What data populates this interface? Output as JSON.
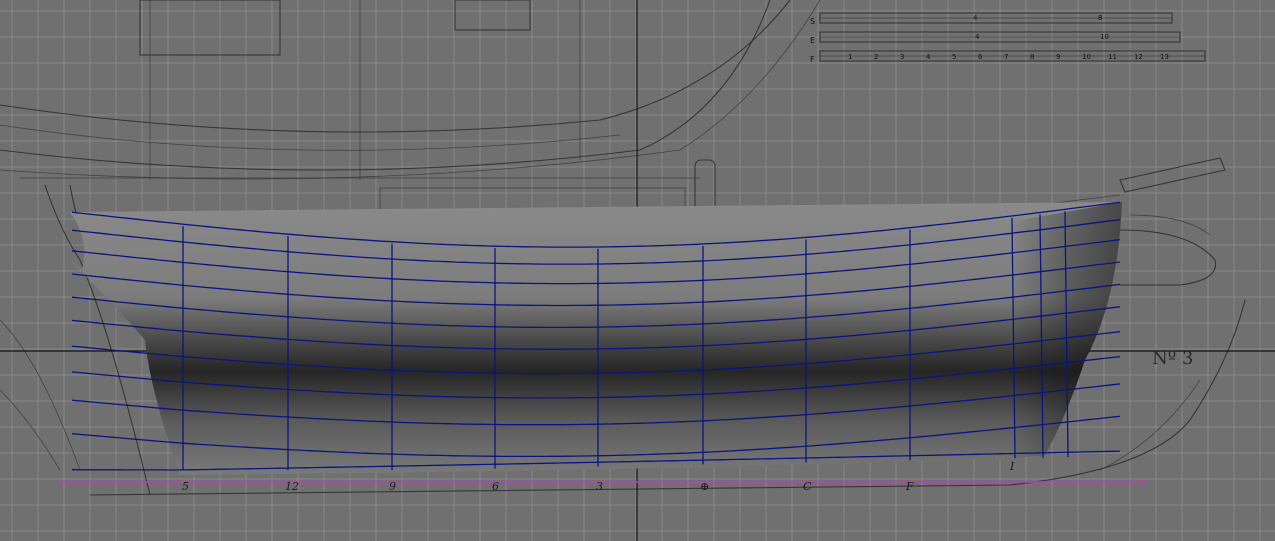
{
  "viewport": {
    "background": "#707070",
    "grid_color": "#9a9a9a",
    "mesh_color": "#0a1580",
    "baseline_color": "#c03bc0"
  },
  "drawing": {
    "plate_label": "Nº 3",
    "scale_bars": [
      {
        "letter": "S",
        "numbers": [
          "4",
          "8"
        ]
      },
      {
        "letter": "E",
        "numbers": [
          "4",
          "10"
        ]
      },
      {
        "letter": "F",
        "numbers": [
          "1",
          "2",
          "3",
          "4",
          "5",
          "6",
          "7",
          "8",
          "9",
          "10",
          "11",
          "12",
          "13"
        ]
      }
    ],
    "station_labels": [
      "5",
      "12",
      "9",
      "6",
      "3",
      "⊕",
      "C",
      "F",
      "I"
    ]
  }
}
